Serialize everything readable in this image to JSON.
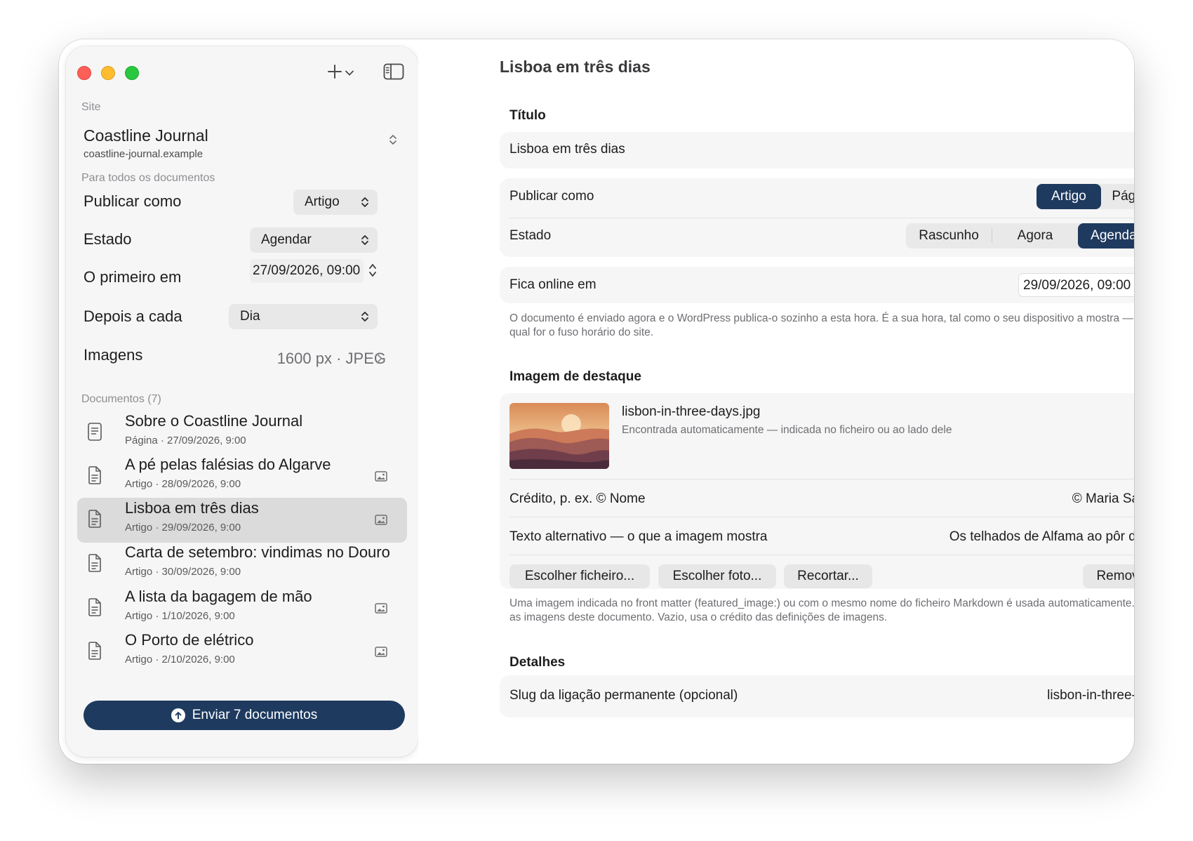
{
  "window": {
    "title": "Lisboa em três dias"
  },
  "sidebar": {
    "site_label": "Site",
    "site_name": "Coastline Journal",
    "site_url": "coastline-journal.example",
    "all_docs_label": "Para todos os documentos",
    "publish_as": {
      "label": "Publicar como",
      "value": "Artigo"
    },
    "status": {
      "label": "Estado",
      "value": "Agendar"
    },
    "first_at": {
      "label": "O primeiro em",
      "value": "27/09/2026, 09:00"
    },
    "every": {
      "label": "Depois a cada",
      "value": "Dia"
    },
    "images": {
      "label": "Imagens",
      "value": "1600 px · JPEG"
    },
    "documents_label": "Documentos (7)",
    "documents": [
      {
        "title": "Sobre o Coastline Journal",
        "subtitle": "Página · 27/09/2026, 9:00",
        "has_image": false,
        "selected": false
      },
      {
        "title": "A pé pelas falésias do Algarve",
        "subtitle": "Artigo · 28/09/2026, 9:00",
        "has_image": true,
        "selected": false
      },
      {
        "title": "Lisboa em três dias",
        "subtitle": "Artigo · 29/09/2026, 9:00",
        "has_image": true,
        "selected": true
      },
      {
        "title": "Carta de setembro: vindimas no Douro",
        "subtitle": "Artigo · 30/09/2026, 9:00",
        "has_image": false,
        "selected": false
      },
      {
        "title": "A lista da bagagem de mão",
        "subtitle": "Artigo · 1/10/2026, 9:00",
        "has_image": true,
        "selected": false
      },
      {
        "title": "O Porto de elétrico",
        "subtitle": "Artigo · 2/10/2026, 9:00",
        "has_image": true,
        "selected": false
      }
    ],
    "send_button": "Enviar 7 documentos"
  },
  "detail": {
    "title_heading": "Título",
    "title_value": "Lisboa em três dias",
    "publish_as_label": "Publicar como",
    "publish_as_options": [
      "Artigo",
      "Página"
    ],
    "publish_as_selected": "Artigo",
    "status_label": "Estado",
    "status_options": [
      "Rascunho",
      "Agora",
      "Agendado"
    ],
    "status_selected": "Agendado",
    "online_label": "Fica online em",
    "online_value": "29/09/2026, 09:00",
    "online_note": "O documento é enviado agora e o WordPress publica-o sozinho a esta hora. É a sua hora, tal como o seu dispositivo a mostra — seja qual for o fuso horário do site.",
    "featured_heading": "Imagem de destaque",
    "image_filename": "lisbon-in-three-days.jpg",
    "image_note": "Encontrada automaticamente — indicada no ficheiro ou ao lado dele",
    "credit_label": "Crédito, p. ex. © Nome",
    "credit_value": "© Maria Santos",
    "alt_label": "Texto alternativo — o que a imagem mostra",
    "alt_value": "Os telhados de Alfama ao pôr do sol",
    "buttons": {
      "choose_file": "Escolher ficheiro...",
      "choose_photo": "Escolher foto...",
      "crop": "Recortar...",
      "remove": "Remover"
    },
    "featured_note": "Uma imagem indicada no front matter (featured_image:) ou com o mesmo nome do ficheiro Markdown é usada automaticamente. Para as imagens deste documento. Vazio, usa o crédito das definições de imagens.",
    "details_heading": "Detalhes",
    "slug_label": "Slug da ligação permanente (opcional)",
    "slug_value": "lisbon-in-three-days"
  },
  "colors": {
    "accent": "#1e3a5f",
    "selection": "#dcdbdb",
    "card": "#f7f6f6"
  },
  "icons": [
    "plus-icon",
    "chevron-down-icon",
    "sidebar-toggle-icon",
    "updown-chevron-icon",
    "chevron-right-icon",
    "document-icon",
    "image-icon",
    "upload-arrow-icon"
  ]
}
